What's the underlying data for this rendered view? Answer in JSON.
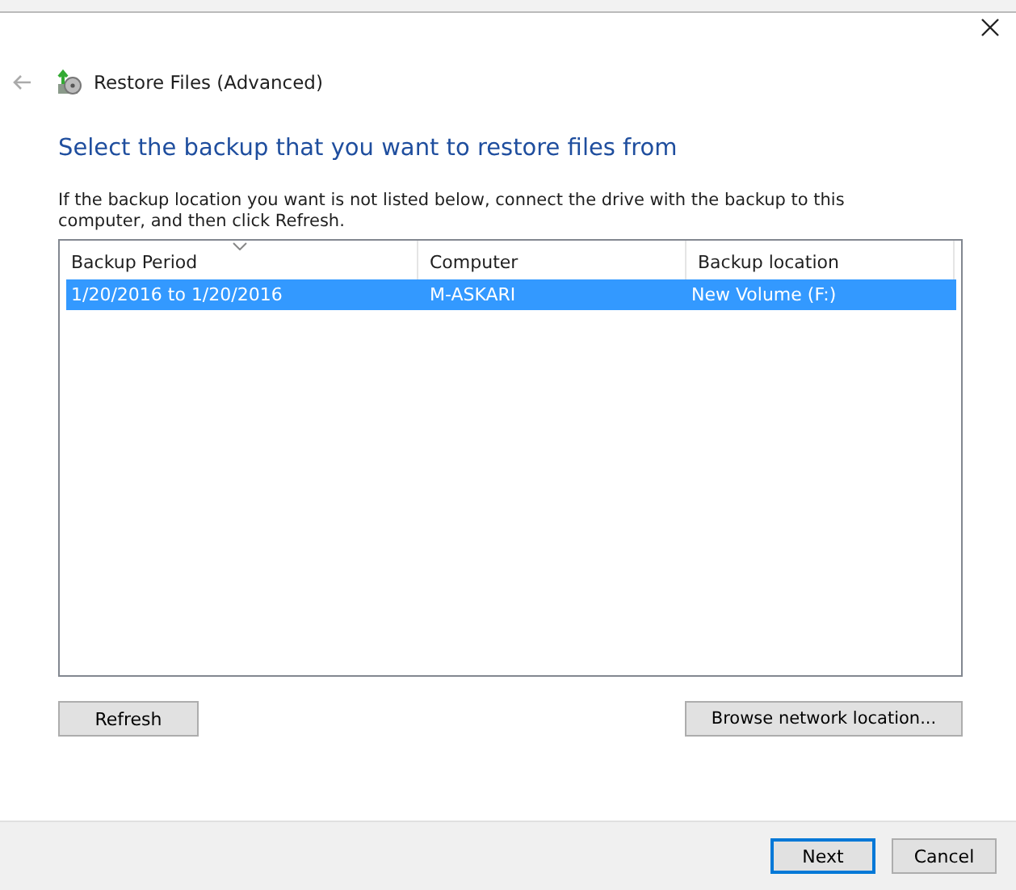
{
  "window": {
    "title": "Restore Files (Advanced)"
  },
  "heading": "Select the backup that you want to restore files from",
  "instruction": "If the backup location you want is not listed below, connect the drive with the backup to this computer, and then click Refresh.",
  "table": {
    "columns": [
      {
        "label": "Backup Period",
        "sorted": true
      },
      {
        "label": "Computer",
        "sorted": false
      },
      {
        "label": "Backup location",
        "sorted": false
      }
    ],
    "rows": [
      {
        "cells": [
          "1/20/2016 to 1/20/2016",
          "M-ASKARI",
          "New Volume (F:)"
        ],
        "selected": true
      }
    ]
  },
  "list_buttons": [
    "Refresh",
    "Browse network location..."
  ],
  "footer_buttons": [
    {
      "label": "Next",
      "default": true
    },
    {
      "label": "Cancel",
      "default": false
    }
  ]
}
